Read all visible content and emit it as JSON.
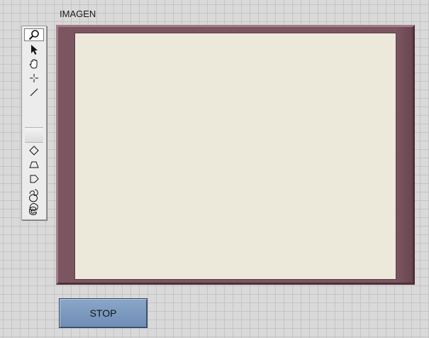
{
  "image_display": {
    "label": "IMAGEN"
  },
  "palette": {
    "tools": [
      {
        "name": "zoom-icon",
        "active": true
      },
      {
        "name": "pointer-icon"
      },
      {
        "name": "pan-hand-icon"
      },
      {
        "name": "crosshair-point-icon"
      },
      {
        "name": "line-icon"
      },
      {
        "name": "rotated-rectangle-icon"
      },
      {
        "name": "annulus-sector-icon"
      },
      {
        "name": "polygon-icon"
      },
      {
        "name": "freehand-icon"
      },
      {
        "name": "freehand-region-icon"
      },
      {
        "name": "oval-icon"
      },
      {
        "name": "annulus-icon"
      }
    ]
  },
  "controls": {
    "stop_label": "STOP"
  }
}
